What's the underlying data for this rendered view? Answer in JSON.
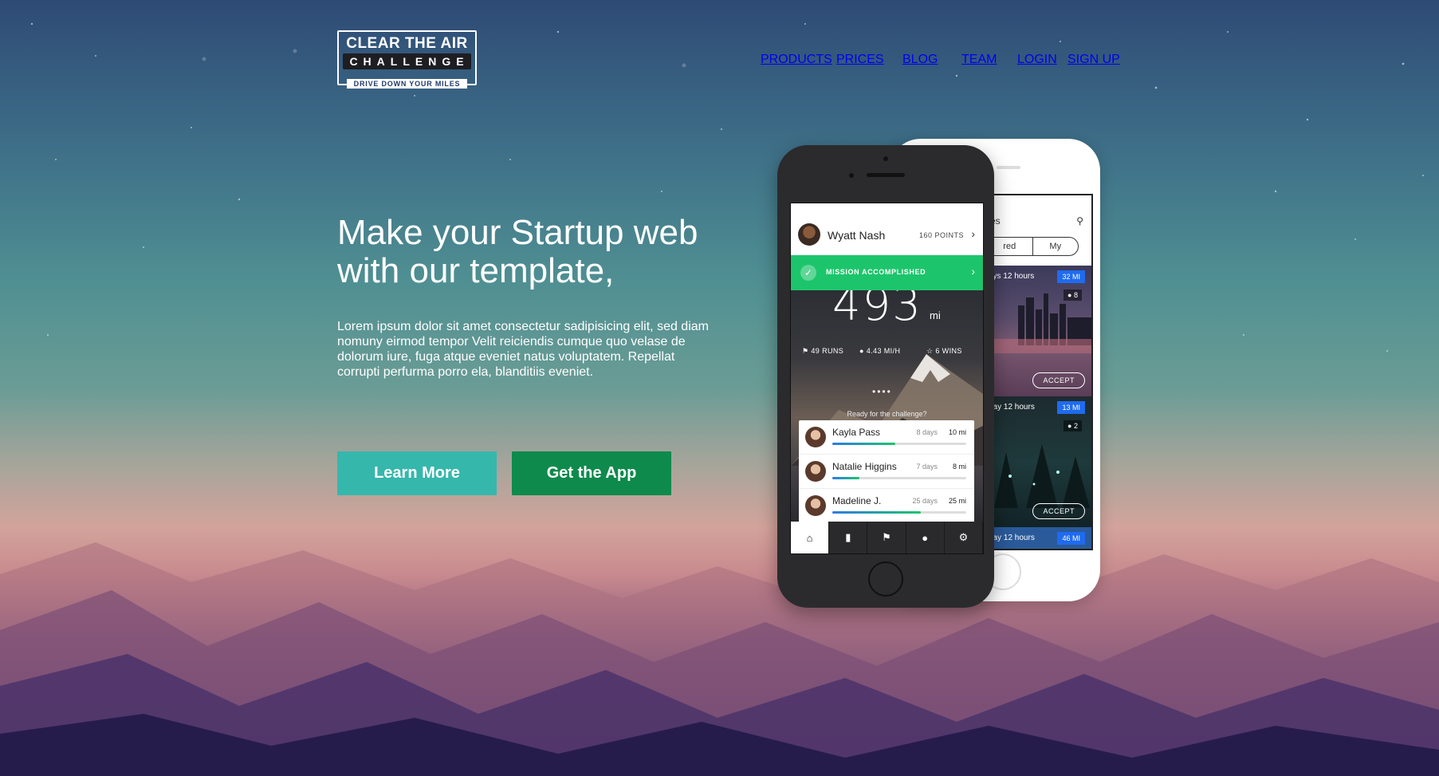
{
  "header": {
    "logo": {
      "line1": "CLEAR THE AIR",
      "line2": "CHALLENGE",
      "tagline": "DRIVE DOWN YOUR MILES"
    },
    "nav": [
      "PRODUCTS",
      "PRICES",
      "BLOG",
      "TEAM",
      "LOGIN",
      "SIGN UP"
    ]
  },
  "hero": {
    "headline": "Make your Startup web with our template,",
    "lead": "Lorem ipsum dolor sit amet consectetur sadipisicing elit, sed diam nomuny eirmod tempor Velit reiciendis cumque quo velase de dolorum iure, fuga atque eveniet natus voluptatem. Repellat corrupti perfurma porro ela, blanditiis eveniet.",
    "learn_more": "Learn More",
    "get_app": "Get the App"
  },
  "app_front": {
    "user_name": "Wyatt Nash",
    "points": "160 POINTS",
    "mission": "MISSION ACCOMPLISHED",
    "big_number": "493",
    "big_unit": "mi",
    "stats": {
      "runs": "49 RUNS",
      "speed": "4.43 MI/H",
      "wins": "6 WINS"
    },
    "pager": "••••",
    "ready": "Ready for the challenge?",
    "leaders": [
      {
        "name": "Kayla Pass",
        "days": "8 days",
        "miles": "10 mi",
        "progress": 0.47
      },
      {
        "name": "Natalie Higgins",
        "days": "7 days",
        "miles": "8 mi",
        "progress": 0.2
      },
      {
        "name": "Madeline J.",
        "days": "25 days",
        "miles": "25 mi",
        "progress": 0.66
      }
    ],
    "tabs": [
      "home-icon",
      "chart-icon",
      "flag-icon",
      "person-icon",
      "gear-icon"
    ]
  },
  "app_back": {
    "title": "es",
    "segment_left": "red",
    "segment_right": "My",
    "cards": [
      {
        "time": "ays 12 hours",
        "miles": "32 MI",
        "people": "8",
        "action": "ACCEPT"
      },
      {
        "time": "day 12 hours",
        "miles": "13 MI",
        "people": "2",
        "action": "ACCEPT"
      },
      {
        "time": "day 12 hours",
        "miles": "46 MI"
      }
    ]
  },
  "colors": {
    "learn_more": "#36b7ac",
    "get_app": "#0e8a4c",
    "mission": "#1cc56b",
    "mile_badge": "#1f6bef"
  }
}
